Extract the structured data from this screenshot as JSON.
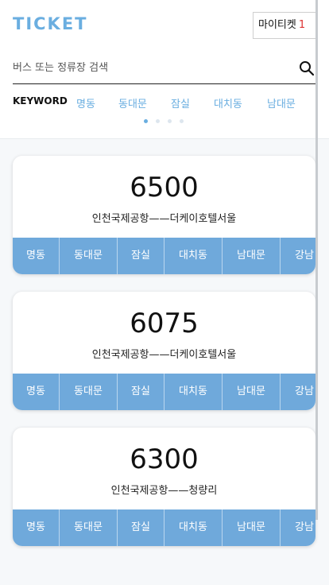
{
  "header": {
    "logo": "TICKET",
    "my_ticket_label": "마이티켓",
    "my_ticket_count": "1"
  },
  "search": {
    "placeholder": "버스 또는 정류장 검색",
    "value": ""
  },
  "keywords": {
    "label": "KEYWORD",
    "items": [
      "명동",
      "동대문",
      "잠실",
      "대치동",
      "남대문"
    ]
  },
  "pager": {
    "total": 4,
    "active": 0
  },
  "cards": [
    {
      "route": "6500",
      "path": "인천국제공항——더케이호텔서울",
      "stops": [
        "명동",
        "동대문",
        "잠실",
        "대치동",
        "남대문",
        "강남"
      ]
    },
    {
      "route": "6075",
      "path": "인천국제공항——더케이호텔서울",
      "stops": [
        "명동",
        "동대문",
        "잠실",
        "대치동",
        "남대문",
        "강남"
      ]
    },
    {
      "route": "6300",
      "path": "인천국제공항——청량리",
      "stops": [
        "명동",
        "동대문",
        "잠실",
        "대치동",
        "남대문",
        "강남"
      ]
    }
  ],
  "colors": {
    "accent": "#6aaee0",
    "stop_bar": "#6fa9db",
    "badge": "#d33333"
  }
}
